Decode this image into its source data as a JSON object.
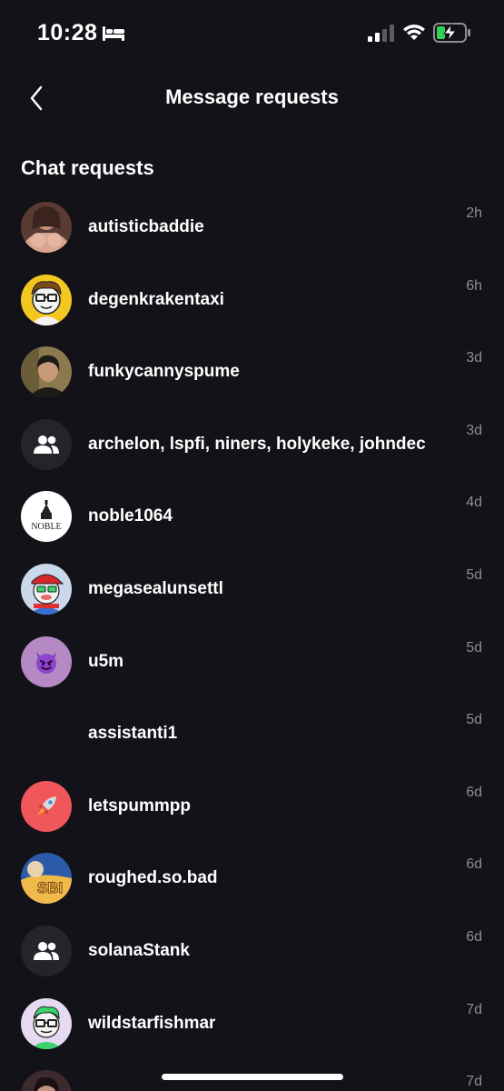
{
  "status": {
    "time": "10:28"
  },
  "header": {
    "title": "Message requests"
  },
  "section": {
    "title": "Chat requests"
  },
  "requests": [
    {
      "name": "autisticbaddie",
      "time": "2h",
      "avatar": "photo-avatar"
    },
    {
      "name": "degenkrakentaxi",
      "time": "6h",
      "avatar": "cartoon-avatar"
    },
    {
      "name": "funkycannyspume",
      "time": "3d",
      "avatar": "photo-avatar"
    },
    {
      "name": "archelon, lspfi, niners, holykeke, johndec",
      "time": "3d",
      "avatar": "group-icon"
    },
    {
      "name": "noble1064",
      "time": "4d",
      "avatar": "noble-logo"
    },
    {
      "name": "megasealunsettl",
      "time": "5d",
      "avatar": "cartoon-avatar"
    },
    {
      "name": "u5m",
      "time": "5d",
      "avatar": "devil-emoji"
    },
    {
      "name": "assistanti1",
      "time": "5d",
      "avatar": "none"
    },
    {
      "name": "letspummpp",
      "time": "6d",
      "avatar": "rocket-emoji"
    },
    {
      "name": "roughed.so.bad",
      "time": "6d",
      "avatar": "sbi-logo"
    },
    {
      "name": "solanaStank",
      "time": "6d",
      "avatar": "group-icon"
    },
    {
      "name": "wildstarfishmar",
      "time": "7d",
      "avatar": "cartoon-avatar"
    },
    {
      "name": "",
      "time": "7d",
      "avatar": "photo-avatar"
    }
  ],
  "colors": {
    "background": "#131218",
    "text": "#ffffff",
    "muted": "#8e8d94",
    "battery_charge": "#30d158"
  }
}
